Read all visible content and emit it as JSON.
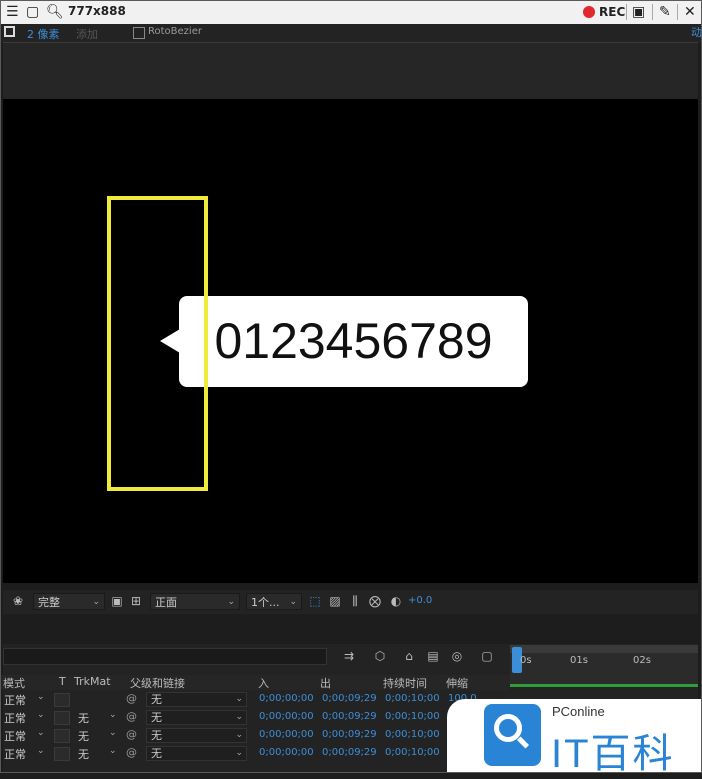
{
  "titlebar": {
    "title": "777x888",
    "rec_label": "REC",
    "icons": [
      "menu-icon",
      "window-icon",
      "search-icon",
      "record-icon",
      "camera-icon",
      "pen-icon",
      "close-icon"
    ]
  },
  "toolbar": {
    "pixel_label": "2 像素",
    "add_label": "添加",
    "rotobezier_label": "RotoBezier",
    "right_label": "动"
  },
  "canvas": {
    "bubble_text": "0123456789",
    "highlight_color": "#f0ea3a"
  },
  "viewer": {
    "quality_select": "完整",
    "view_select": "正面",
    "views_select": "1个...",
    "exposure_value": "+0.0"
  },
  "timeline": {
    "ruler_labels": [
      "0s",
      "01s",
      "02s"
    ],
    "columns": {
      "mode": "模式",
      "t": "T",
      "trkmat": "TrkMat",
      "parent": "父级和链接",
      "in": "入",
      "out": "出",
      "duration": "持续时间",
      "stretch": "伸缩"
    },
    "rows": [
      {
        "mode": "正常",
        "trkmat": "",
        "parent": "无",
        "in": "0;00;00;00",
        "out": "0;00;09;29",
        "duration": "0;00;10;00",
        "stretch": "100.0"
      },
      {
        "mode": "正常",
        "trkmat": "无",
        "parent": "无",
        "in": "0;00;00;00",
        "out": "0;00;09;29",
        "duration": "0;00;10;00",
        "stretch": ""
      },
      {
        "mode": "正常",
        "trkmat": "无",
        "parent": "无",
        "in": "0;00;00;00",
        "out": "0;00;09;29",
        "duration": "0;00;10;00",
        "stretch": ""
      },
      {
        "mode": "正常",
        "trkmat": "无",
        "parent": "无",
        "in": "0;00;00;00",
        "out": "0;00;09;29",
        "duration": "0;00;10;00",
        "stretch": ""
      }
    ]
  },
  "watermark": {
    "sub": "PConline",
    "main": "IT百科"
  }
}
